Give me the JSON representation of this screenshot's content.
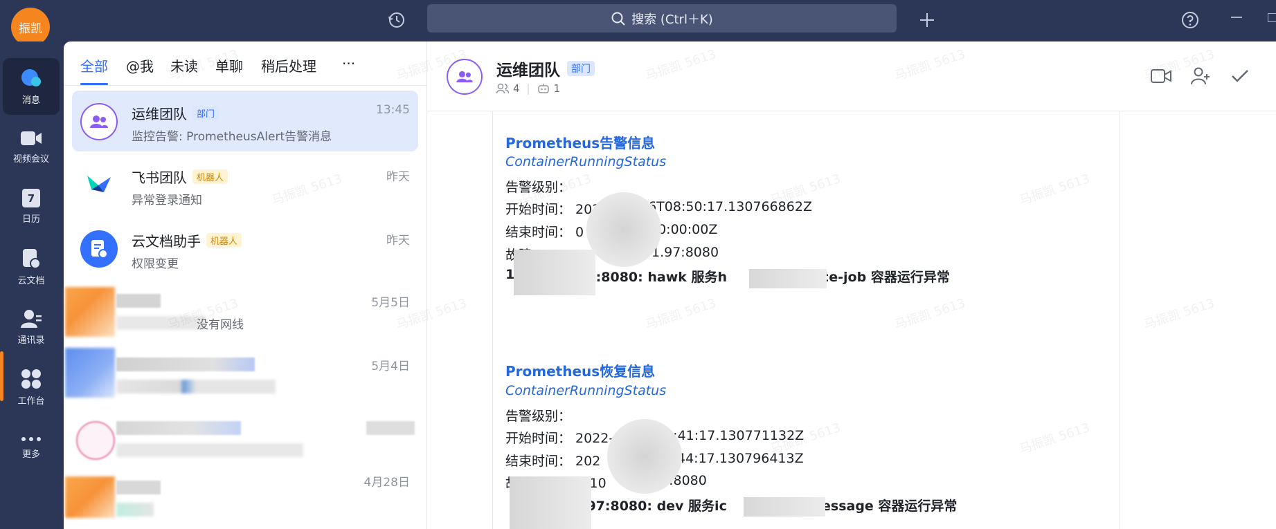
{
  "topbar": {
    "user_avatar_text": "振凯",
    "search_placeholder": "搜索 (Ctrl＋K)"
  },
  "rail": {
    "items": [
      {
        "label": "消息",
        "icon": "chat-bubble-icon"
      },
      {
        "label": "视频会议",
        "icon": "video-camera-icon"
      },
      {
        "label": "日历",
        "icon": "calendar-icon"
      },
      {
        "label": "云文档",
        "icon": "cloud-doc-icon"
      },
      {
        "label": "通讯录",
        "icon": "contacts-icon"
      },
      {
        "label": "工作台",
        "icon": "workspace-grid-icon"
      },
      {
        "label": "更多",
        "icon": "more-dots-icon"
      }
    ],
    "calendar_day": "7"
  },
  "list": {
    "tabs": [
      "全部",
      "@我",
      "未读",
      "单聊",
      "稍后处理",
      "···"
    ],
    "conversations": [
      {
        "name": "运维团队",
        "badge": "部门",
        "sub": "监控告警: PrometheusAlert告警消息",
        "time": "13:45"
      },
      {
        "name": "飞书团队",
        "badge": "机器人",
        "sub": "异常登录通知",
        "time": "昨天"
      },
      {
        "name": "云文档助手",
        "badge": "机器人",
        "sub": "权限变更",
        "time": "昨天"
      },
      {
        "name": "",
        "badge": "",
        "sub": "没有网线",
        "time": "5月5日"
      },
      {
        "name": "",
        "badge": "",
        "sub": "",
        "time": "5月4日"
      },
      {
        "name": "",
        "badge": "",
        "sub": "",
        "time": ""
      },
      {
        "name": "",
        "badge": "",
        "sub": "",
        "time": "4月28日"
      }
    ]
  },
  "chat": {
    "title": "运维团队",
    "badge": "部门",
    "members_count": "4",
    "bots_count": "1",
    "messages": [
      {
        "title": "Prometheus告警信息",
        "subtitle": "ContainerRunningStatus",
        "level": "告警级别：",
        "start": "开始时间：  202",
        "start_tail": "06T08:50:17.130766862Z",
        "end": "结束时间：  0",
        "end_tail": "00:00:00Z",
        "host": "故障",
        "host_tail": "1.97:8080",
        "summary_head": "1",
        "summary_mid": ".97:8080: hawk 服务h",
        "summary_tail": "ce-job 容器运行异常"
      },
      {
        "title": "Prometheus恢复信息",
        "subtitle": "ContainerRunningStatus",
        "level": "告警级别：",
        "start": "开始时间：  2022-0",
        "start_tail": "05:41:17.130771132Z",
        "end": "结束时间：  202",
        "end_tail": "44:17.130796413Z",
        "host": "故",
        "host_tail": "P：  10",
        "host_tail2": "7:8080",
        "summary_head": "",
        "summary_mid": "1.97:8080: dev 服务ic",
        "summary_tail": "essage 容器运行异常"
      }
    ]
  },
  "watermark": "马振凯 5613",
  "colors": {
    "accent": "#3370ff",
    "topbar": "#2c3757",
    "brand_orange": "#f5861f"
  }
}
